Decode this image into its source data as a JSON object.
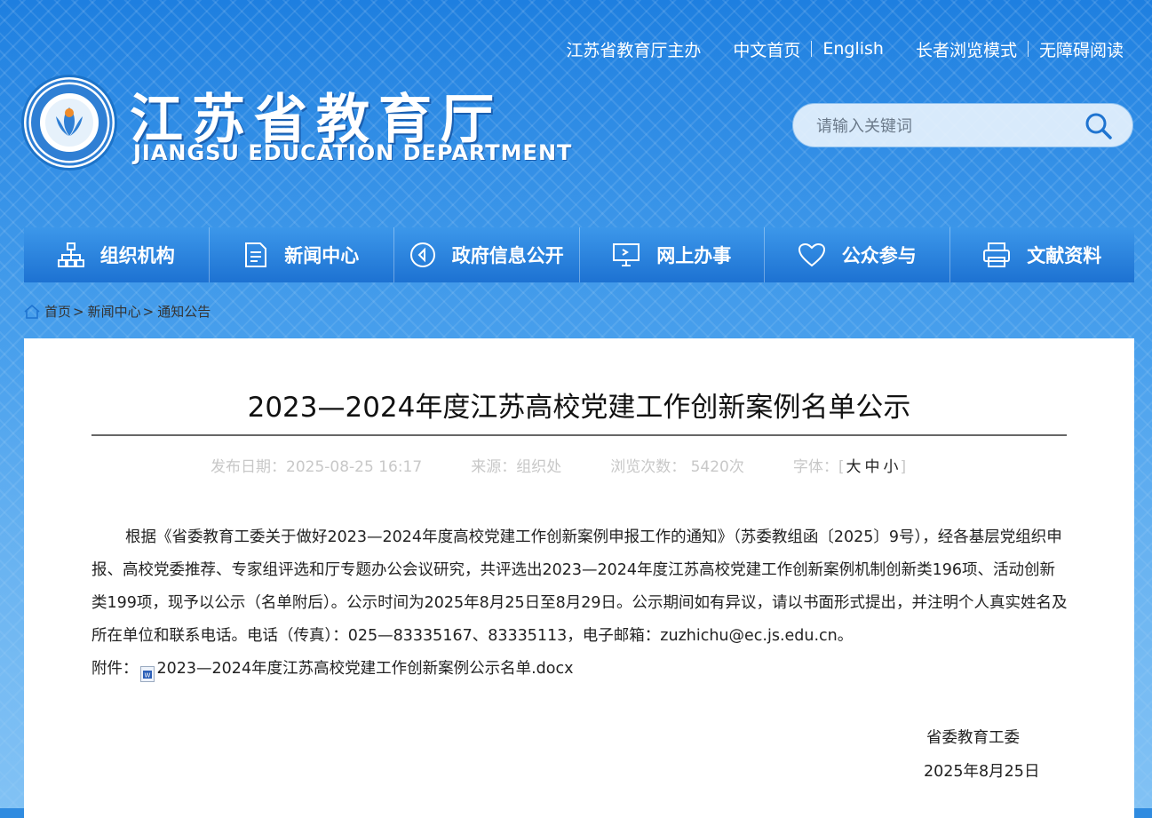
{
  "header": {
    "links": [
      "江苏省教育厅主办",
      "中文首页",
      "English",
      "长者浏览模式",
      "无障碍阅读"
    ],
    "title": "江苏省教育厅",
    "subtitle": "JIANGSU EDUCATION DEPARTMENT",
    "search_placeholder": "请输入关键词"
  },
  "nav": [
    {
      "label": "组织机构",
      "icon": "org-chart-icon"
    },
    {
      "label": "新闻中心",
      "icon": "document-icon"
    },
    {
      "label": "政府信息公开",
      "icon": "play-circle-icon"
    },
    {
      "label": "网上办事",
      "icon": "monitor-icon"
    },
    {
      "label": "公众参与",
      "icon": "heart-icon"
    },
    {
      "label": "文献资料",
      "icon": "printer-icon"
    }
  ],
  "breadcrumb": [
    "首页",
    "新闻中心",
    "通知公告"
  ],
  "article": {
    "title": "2023—2024年度江苏高校党建工作创新案例名单公示",
    "meta": {
      "date": "发布日期：2025-08-25 16:17",
      "source": "来源：组织处",
      "views": "浏览次数： 5420次",
      "font_label": "字体：[",
      "font_sizes": [
        "大",
        "中",
        "小"
      ],
      "font_close": "]"
    },
    "paragraph": "根据《省委教育工委关于做好2023—2024年度高校党建工作创新案例申报工作的通知》（苏委教组函〔2025〕9号），经各基层党组织申报、高校党委推荐、专家组评选和厅专题办公会议研究，共评选出2023—2024年度江苏高校党建工作创新案例机制创新类196项、活动创新类199项，现予以公示（名单附后）。公示时间为2025年8月25日至8月29日。公示期间如有异议，请以书面形式提出，并注明个人真实姓名及所在单位和联系电话。电话（传真）：025—83335167、83335113，电子邮箱：zuzhichu@ec.js.edu.cn。",
    "attachment_label": "附件：",
    "attachment_name": "2023—2024年度江苏高校党建工作创新案例公示名单.docx",
    "signature": "省委教育工委",
    "sign_date": "2025年8月25日"
  }
}
